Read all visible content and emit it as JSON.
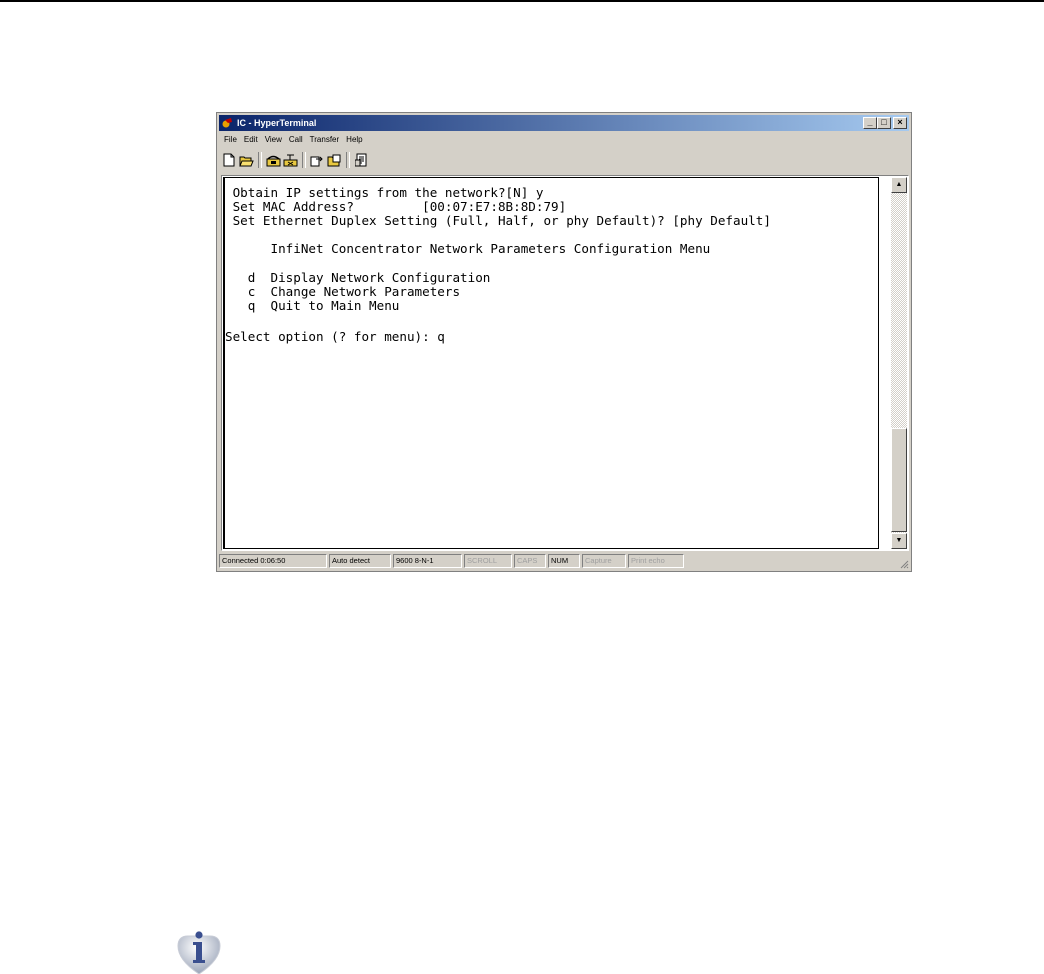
{
  "window": {
    "title": "IC - HyperTerminal",
    "buttons": {
      "minimize": "_",
      "maximize": "□",
      "close": "×"
    }
  },
  "menu": [
    "File",
    "Edit",
    "View",
    "Call",
    "Transfer",
    "Help"
  ],
  "toolbar_icons": [
    "new-document-icon",
    "open-folder-icon",
    "connect-phone-icon",
    "disconnect-phone-icon",
    "send-file-icon",
    "receive-file-icon",
    "properties-icon"
  ],
  "terminal": {
    "lines": [
      " Obtain IP settings from the network?[N] y",
      " Set MAC Address?         [00:07:E7:8B:8D:79]",
      " Set Ethernet Duplex Setting (Full, Half, or phy Default)? [phy Default]",
      "",
      "      InfiNet Concentrator Network Parameters Configuration Menu",
      "",
      "   d  Display Network Configuration",
      "   c  Change Network Parameters",
      "   q  Quit to Main Menu",
      "",
      "Select option (? for menu): q"
    ]
  },
  "status": {
    "connected": "Connected 0:06:50",
    "detect": "Auto detect",
    "settings": "9600 8-N-1",
    "scroll": "SCROLL",
    "caps": "CAPS",
    "num": "NUM",
    "capture": "Capture",
    "print_echo": "Print echo"
  }
}
